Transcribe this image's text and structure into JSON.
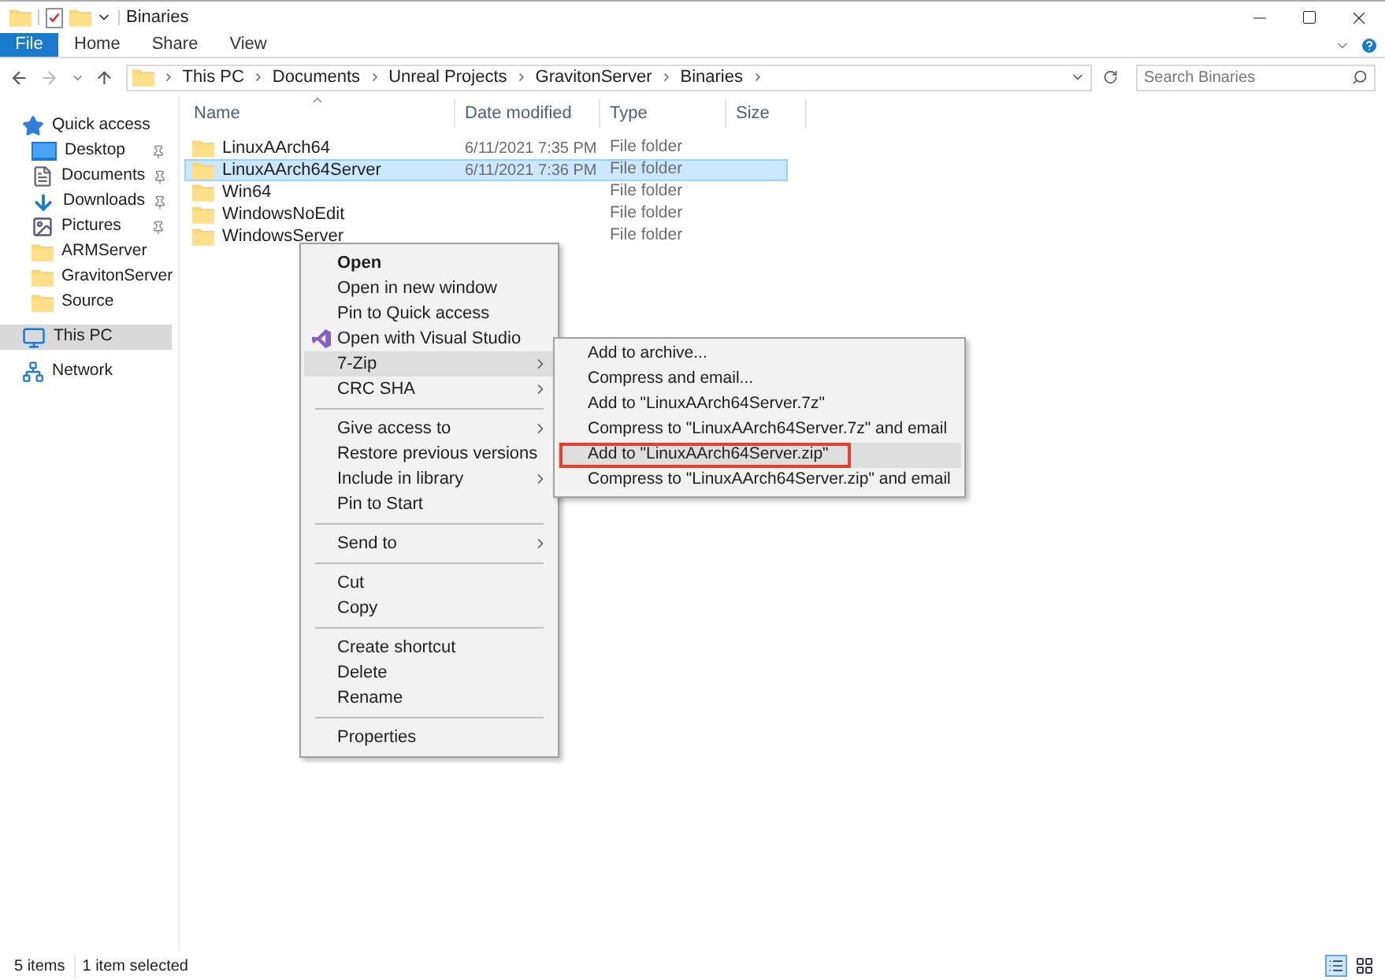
{
  "window": {
    "title": "Binaries"
  },
  "ribbon": {
    "tabs": [
      {
        "label": "File",
        "kind": "file",
        "selected": false
      },
      {
        "label": "Home",
        "kind": "tab",
        "selected": false
      },
      {
        "label": "Share",
        "kind": "tab",
        "selected": false
      },
      {
        "label": "View",
        "kind": "tab",
        "selected": false
      }
    ]
  },
  "address": {
    "segments": [
      "This PC",
      "Documents",
      "Unreal Projects",
      "GravitonServer",
      "Binaries"
    ],
    "search": {
      "placeholder": "Search Binaries"
    }
  },
  "sidebar": {
    "items": [
      {
        "label": "Quick access",
        "kind": "star",
        "selected": false,
        "children": [
          {
            "label": "Desktop",
            "kind": "desktop",
            "pinned": true,
            "selected": false
          },
          {
            "label": "Documents",
            "kind": "documents",
            "pinned": true,
            "selected": false
          },
          {
            "label": "Downloads",
            "kind": "downloads",
            "pinned": true,
            "selected": false
          },
          {
            "label": "Pictures",
            "kind": "pictures",
            "pinned": true,
            "selected": false
          },
          {
            "label": "ARMServer",
            "kind": "folder",
            "pinned": false,
            "selected": false
          },
          {
            "label": "GravitonServer",
            "kind": "folder",
            "pinned": false,
            "selected": false
          },
          {
            "label": "Source",
            "kind": "folder",
            "pinned": false,
            "selected": false
          }
        ]
      },
      {
        "label": "This PC",
        "kind": "pc",
        "selected": true
      },
      {
        "label": "Network",
        "kind": "network",
        "selected": false
      }
    ]
  },
  "table": {
    "columns": [
      {
        "label": "Name",
        "sorted": true
      },
      {
        "label": "Date modified",
        "sorted": false
      },
      {
        "label": "Type",
        "sorted": false
      },
      {
        "label": "Size",
        "sorted": false
      }
    ],
    "rows": [
      {
        "name": "LinuxAArch64",
        "date": "6/11/2021 7:35 PM",
        "type": "File folder",
        "selected": false
      },
      {
        "name": "LinuxAArch64Server",
        "date": "6/11/2021 7:36 PM",
        "type": "File folder",
        "selected": true
      },
      {
        "name": "Win64",
        "type": "File folder",
        "selected": false
      },
      {
        "name": "WindowsNoEdit",
        "type": "File folder",
        "selected": false
      },
      {
        "name": "WindowsServer",
        "type": "File folder",
        "selected": false
      }
    ]
  },
  "context_menu": {
    "items": [
      {
        "kind": "item",
        "label": "Open",
        "default": true,
        "submenu": false,
        "selected": false
      },
      {
        "kind": "item",
        "label": "Open in new window",
        "default": false,
        "submenu": false,
        "selected": false
      },
      {
        "kind": "item",
        "label": "Pin to Quick access",
        "default": false,
        "submenu": false,
        "selected": false
      },
      {
        "kind": "vs",
        "label": "Open with Visual Studio",
        "default": false,
        "submenu": false,
        "selected": false
      },
      {
        "kind": "item",
        "label": "7-Zip",
        "default": false,
        "submenu": true,
        "selected": true
      },
      {
        "kind": "item",
        "label": "CRC SHA",
        "default": false,
        "submenu": true,
        "selected": false
      },
      {
        "kind": "separator"
      },
      {
        "kind": "item",
        "label": "Give access to",
        "default": false,
        "submenu": true,
        "selected": false
      },
      {
        "kind": "item",
        "label": "Restore previous versions",
        "default": false,
        "submenu": false,
        "selected": false
      },
      {
        "kind": "item",
        "label": "Include in library",
        "default": false,
        "submenu": true,
        "selected": false
      },
      {
        "kind": "item",
        "label": "Pin to Start",
        "default": false,
        "submenu": false,
        "selected": false
      },
      {
        "kind": "separator"
      },
      {
        "kind": "item",
        "label": "Send to",
        "default": false,
        "submenu": true,
        "selected": false
      },
      {
        "kind": "separator"
      },
      {
        "kind": "item",
        "label": "Cut",
        "default": false,
        "submenu": false,
        "selected": false
      },
      {
        "kind": "item",
        "label": "Copy",
        "default": false,
        "submenu": false,
        "selected": false
      },
      {
        "kind": "separator"
      },
      {
        "kind": "item",
        "label": "Create shortcut",
        "default": false,
        "submenu": false,
        "selected": false
      },
      {
        "kind": "item",
        "label": "Delete",
        "default": false,
        "submenu": false,
        "selected": false
      },
      {
        "kind": "item",
        "label": "Rename",
        "default": false,
        "submenu": false,
        "selected": false
      },
      {
        "kind": "separator"
      },
      {
        "kind": "item",
        "label": "Properties",
        "default": false,
        "submenu": false,
        "selected": false
      }
    ]
  },
  "submenu": {
    "items": [
      {
        "label": "Add to archive...",
        "selected": false,
        "outlined": false
      },
      {
        "label": "Compress and email...",
        "selected": false,
        "outlined": false
      },
      {
        "label": "Add to \"LinuxAArch64Server.7z\"",
        "selected": false,
        "outlined": false
      },
      {
        "label": "Compress to \"LinuxAArch64Server.7z\" and email",
        "selected": false,
        "outlined": false
      },
      {
        "label": "Add to \"LinuxAArch64Server.zip\"",
        "selected": true,
        "outlined": true
      },
      {
        "label": "Compress to \"LinuxAArch64Server.zip\" and email",
        "selected": false,
        "outlined": false
      }
    ]
  },
  "status_bar": {
    "items": [
      "5 items",
      "1 item selected"
    ],
    "views": [
      {
        "kind": "details",
        "selected": true
      },
      {
        "kind": "tiles",
        "selected": false
      }
    ]
  }
}
